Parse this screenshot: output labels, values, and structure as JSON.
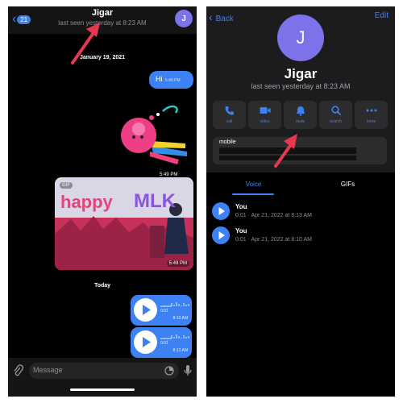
{
  "colors": {
    "accent": "#3d82f5",
    "arrow": "#e8384f",
    "background": "#000000",
    "panel": "#1c1c1e",
    "card": "#2c2c2e",
    "avatar": "#7e72eb"
  },
  "chat": {
    "back_count": "21",
    "title": "Jigar",
    "subtitle": "last seen yesterday at 8:23 AM",
    "avatar_initial": "J",
    "date_label": "January 19, 2021",
    "today_label": "Today",
    "messages": {
      "hi": {
        "text": "Hi",
        "time": "5:49 PM"
      },
      "sticker": {
        "time": "5:49 PM",
        "icon": "sticker-icon"
      },
      "gif": {
        "badge": "GIF",
        "word1": "happy",
        "word2": "MLK",
        "time": "5:49 PM"
      },
      "voice": [
        {
          "duration": "0:01",
          "time": "8:10 AM"
        },
        {
          "duration": "0:01",
          "time": "8:13 AM"
        }
      ]
    },
    "input_placeholder": "Message"
  },
  "profile": {
    "back_label": "Back",
    "edit_label": "Edit",
    "avatar_initial": "J",
    "name": "Jigar",
    "status": "last seen yesterday at 8:23 AM",
    "actions": [
      {
        "label": "call",
        "icon": "phone-icon"
      },
      {
        "label": "video",
        "icon": "video-icon"
      },
      {
        "label": "mute",
        "icon": "bell-icon"
      },
      {
        "label": "search",
        "icon": "search-icon"
      },
      {
        "label": "more",
        "icon": "more-icon"
      }
    ],
    "info_label": "mobile",
    "tabs": [
      "Voice",
      "GIFs"
    ],
    "voice_items": [
      {
        "name": "You",
        "meta": "0:01 · Apr 21, 2022 at 8:13 AM"
      },
      {
        "name": "You",
        "meta": "0:01 · Apr 21, 2022 at 8:10 AM"
      }
    ]
  }
}
